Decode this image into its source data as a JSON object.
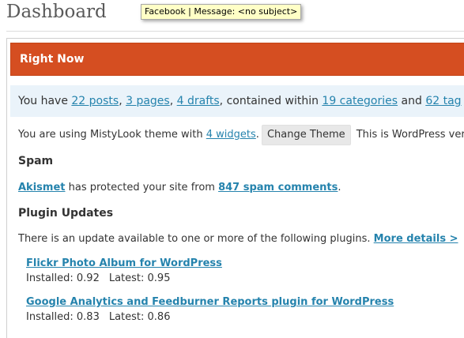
{
  "page": {
    "title": "Dashboard"
  },
  "tooltip": {
    "text": "Facebook | Message: <no subject>"
  },
  "right_now": {
    "header": "Right Now",
    "stats": {
      "prefix": "You have ",
      "posts": "22 posts",
      "sep1": ", ",
      "pages": "3 pages",
      "sep2": ", ",
      "drafts": "4 drafts",
      "mid": ", contained within ",
      "categories": "19 categories",
      "and": " and ",
      "tags": "62 tag"
    },
    "theme": {
      "prefix": "You are using MistyLook theme with ",
      "widgets": "4 widgets",
      "period": ".",
      "change_button": "Change Theme",
      "version_text": "This is WordPress version"
    }
  },
  "spam": {
    "heading": "Spam",
    "akismet": "Akismet",
    "middle": " has protected your site from ",
    "count_link": "847 spam comments",
    "end": "."
  },
  "plugin_updates": {
    "heading": "Plugin Updates",
    "notice": "There is an update available to one or more of the following plugins. ",
    "more_details": "More details >",
    "plugins": [
      {
        "name": "Flickr Photo Album for WordPress",
        "installed": "Installed: 0.92",
        "latest": "Latest: 0.95"
      },
      {
        "name": "Google Analytics and Feedburner Reports plugin for WordPress",
        "installed": "Installed: 0.83",
        "latest": "Latest: 0.86"
      }
    ]
  }
}
